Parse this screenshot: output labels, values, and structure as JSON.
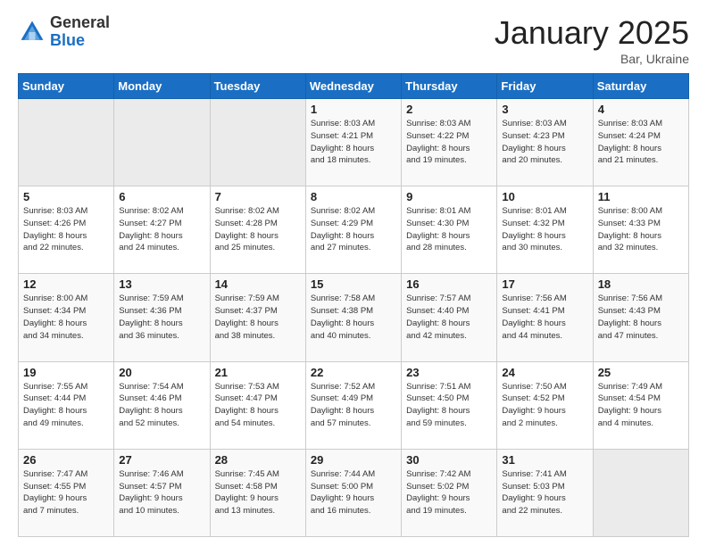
{
  "logo": {
    "general": "General",
    "blue": "Blue"
  },
  "header": {
    "month": "January 2025",
    "location": "Bar, Ukraine"
  },
  "weekdays": [
    "Sunday",
    "Monday",
    "Tuesday",
    "Wednesday",
    "Thursday",
    "Friday",
    "Saturday"
  ],
  "weeks": [
    [
      {
        "day": "",
        "info": ""
      },
      {
        "day": "",
        "info": ""
      },
      {
        "day": "",
        "info": ""
      },
      {
        "day": "1",
        "info": "Sunrise: 8:03 AM\nSunset: 4:21 PM\nDaylight: 8 hours\nand 18 minutes."
      },
      {
        "day": "2",
        "info": "Sunrise: 8:03 AM\nSunset: 4:22 PM\nDaylight: 8 hours\nand 19 minutes."
      },
      {
        "day": "3",
        "info": "Sunrise: 8:03 AM\nSunset: 4:23 PM\nDaylight: 8 hours\nand 20 minutes."
      },
      {
        "day": "4",
        "info": "Sunrise: 8:03 AM\nSunset: 4:24 PM\nDaylight: 8 hours\nand 21 minutes."
      }
    ],
    [
      {
        "day": "5",
        "info": "Sunrise: 8:03 AM\nSunset: 4:26 PM\nDaylight: 8 hours\nand 22 minutes."
      },
      {
        "day": "6",
        "info": "Sunrise: 8:02 AM\nSunset: 4:27 PM\nDaylight: 8 hours\nand 24 minutes."
      },
      {
        "day": "7",
        "info": "Sunrise: 8:02 AM\nSunset: 4:28 PM\nDaylight: 8 hours\nand 25 minutes."
      },
      {
        "day": "8",
        "info": "Sunrise: 8:02 AM\nSunset: 4:29 PM\nDaylight: 8 hours\nand 27 minutes."
      },
      {
        "day": "9",
        "info": "Sunrise: 8:01 AM\nSunset: 4:30 PM\nDaylight: 8 hours\nand 28 minutes."
      },
      {
        "day": "10",
        "info": "Sunrise: 8:01 AM\nSunset: 4:32 PM\nDaylight: 8 hours\nand 30 minutes."
      },
      {
        "day": "11",
        "info": "Sunrise: 8:00 AM\nSunset: 4:33 PM\nDaylight: 8 hours\nand 32 minutes."
      }
    ],
    [
      {
        "day": "12",
        "info": "Sunrise: 8:00 AM\nSunset: 4:34 PM\nDaylight: 8 hours\nand 34 minutes."
      },
      {
        "day": "13",
        "info": "Sunrise: 7:59 AM\nSunset: 4:36 PM\nDaylight: 8 hours\nand 36 minutes."
      },
      {
        "day": "14",
        "info": "Sunrise: 7:59 AM\nSunset: 4:37 PM\nDaylight: 8 hours\nand 38 minutes."
      },
      {
        "day": "15",
        "info": "Sunrise: 7:58 AM\nSunset: 4:38 PM\nDaylight: 8 hours\nand 40 minutes."
      },
      {
        "day": "16",
        "info": "Sunrise: 7:57 AM\nSunset: 4:40 PM\nDaylight: 8 hours\nand 42 minutes."
      },
      {
        "day": "17",
        "info": "Sunrise: 7:56 AM\nSunset: 4:41 PM\nDaylight: 8 hours\nand 44 minutes."
      },
      {
        "day": "18",
        "info": "Sunrise: 7:56 AM\nSunset: 4:43 PM\nDaylight: 8 hours\nand 47 minutes."
      }
    ],
    [
      {
        "day": "19",
        "info": "Sunrise: 7:55 AM\nSunset: 4:44 PM\nDaylight: 8 hours\nand 49 minutes."
      },
      {
        "day": "20",
        "info": "Sunrise: 7:54 AM\nSunset: 4:46 PM\nDaylight: 8 hours\nand 52 minutes."
      },
      {
        "day": "21",
        "info": "Sunrise: 7:53 AM\nSunset: 4:47 PM\nDaylight: 8 hours\nand 54 minutes."
      },
      {
        "day": "22",
        "info": "Sunrise: 7:52 AM\nSunset: 4:49 PM\nDaylight: 8 hours\nand 57 minutes."
      },
      {
        "day": "23",
        "info": "Sunrise: 7:51 AM\nSunset: 4:50 PM\nDaylight: 8 hours\nand 59 minutes."
      },
      {
        "day": "24",
        "info": "Sunrise: 7:50 AM\nSunset: 4:52 PM\nDaylight: 9 hours\nand 2 minutes."
      },
      {
        "day": "25",
        "info": "Sunrise: 7:49 AM\nSunset: 4:54 PM\nDaylight: 9 hours\nand 4 minutes."
      }
    ],
    [
      {
        "day": "26",
        "info": "Sunrise: 7:47 AM\nSunset: 4:55 PM\nDaylight: 9 hours\nand 7 minutes."
      },
      {
        "day": "27",
        "info": "Sunrise: 7:46 AM\nSunset: 4:57 PM\nDaylight: 9 hours\nand 10 minutes."
      },
      {
        "day": "28",
        "info": "Sunrise: 7:45 AM\nSunset: 4:58 PM\nDaylight: 9 hours\nand 13 minutes."
      },
      {
        "day": "29",
        "info": "Sunrise: 7:44 AM\nSunset: 5:00 PM\nDaylight: 9 hours\nand 16 minutes."
      },
      {
        "day": "30",
        "info": "Sunrise: 7:42 AM\nSunset: 5:02 PM\nDaylight: 9 hours\nand 19 minutes."
      },
      {
        "day": "31",
        "info": "Sunrise: 7:41 AM\nSunset: 5:03 PM\nDaylight: 9 hours\nand 22 minutes."
      },
      {
        "day": "",
        "info": ""
      }
    ]
  ]
}
